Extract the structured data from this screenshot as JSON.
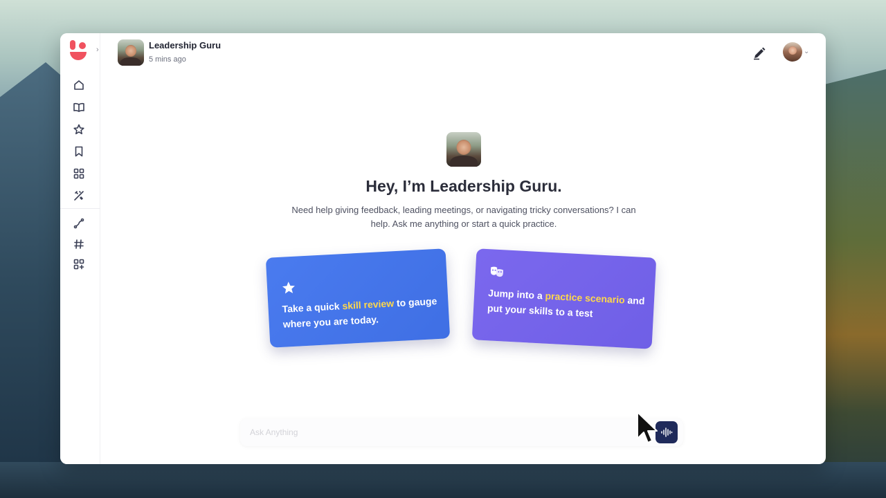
{
  "app": {
    "sidebar": {
      "expand_glyph": "›",
      "items": [
        {
          "icon": "home-icon"
        },
        {
          "icon": "book-icon"
        },
        {
          "icon": "star-icon"
        },
        {
          "icon": "bookmark-icon"
        },
        {
          "icon": "grid-icon"
        },
        {
          "icon": "skills-icon"
        },
        {
          "icon": "path-icon"
        },
        {
          "icon": "hashtag-icon"
        },
        {
          "icon": "apps-add-icon"
        }
      ]
    },
    "header": {
      "title": "Leadership Guru",
      "subtitle": "5 mins ago",
      "user_chevron": "⌄"
    },
    "main": {
      "title": "Hey, I’m Leadership Guru.",
      "description": "Need help giving feedback, leading meetings, or navigating tricky conversations? I can help. Ask me anything or start a quick practice."
    },
    "cards": [
      {
        "icon": "star-icon",
        "text_before": "Take a quick ",
        "highlight": "skill review",
        "text_after": " to gauge where you are today."
      },
      {
        "icon": "theater-masks-icon",
        "text_before": "Jump into a ",
        "highlight": "practice scenario",
        "text_after": " and put your skills to a test"
      }
    ],
    "composer": {
      "placeholder": "Ask Anything",
      "value": ""
    },
    "colors": {
      "brand": "#f0525f",
      "card_blue": "#4a7bef",
      "card_purple": "#7b68ee",
      "highlight": "#ffd84a",
      "voice_button": "#1f2a5a"
    }
  }
}
